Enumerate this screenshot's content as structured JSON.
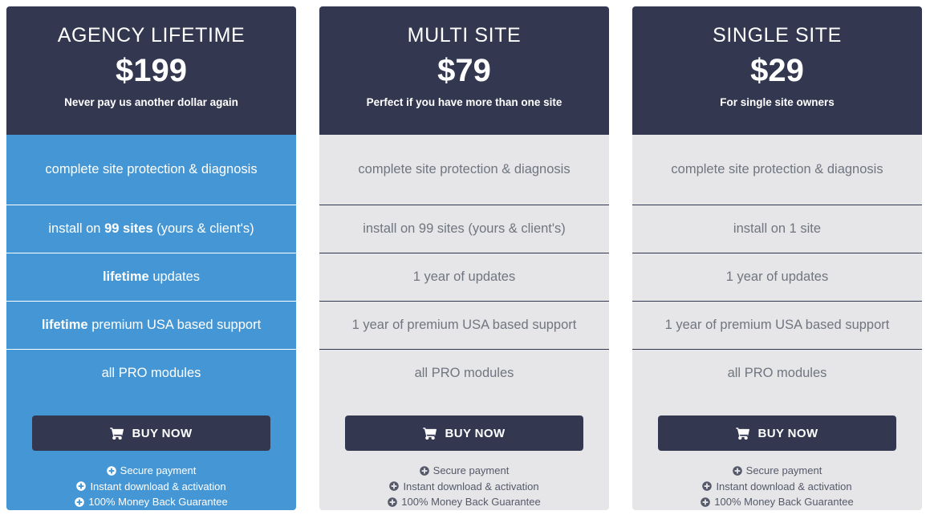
{
  "cards": [
    {
      "style": "featured",
      "plan_name": "AGENCY LIFETIME",
      "price": "$199",
      "tagline": "Never pay us another dollar again",
      "features": [
        {
          "pre": "complete site protection & diagnosis",
          "strong": "",
          "post": ""
        },
        {
          "pre": "install on ",
          "strong": "99 sites",
          "post": " (yours & client's)"
        },
        {
          "pre": "",
          "strong": "lifetime",
          "post": " updates"
        },
        {
          "pre": "",
          "strong": "lifetime",
          "post": " premium USA based support"
        }
      ],
      "modules_prefix": "all ",
      "modules_link": "PRO modules",
      "buy_label": "BUY NOW",
      "guarantees": [
        "Secure payment",
        "Instant download & activation",
        "100% Money Back Guarantee"
      ]
    },
    {
      "style": "standard",
      "plan_name": "MULTI SITE",
      "price": "$79",
      "tagline": "Perfect if you have more than one site",
      "features": [
        {
          "pre": "complete site protection & diagnosis",
          "strong": "",
          "post": ""
        },
        {
          "pre": "install on 99 sites (yours & client's)",
          "strong": "",
          "post": ""
        },
        {
          "pre": "1 year of updates",
          "strong": "",
          "post": ""
        },
        {
          "pre": "1 year of premium USA based support",
          "strong": "",
          "post": ""
        }
      ],
      "modules_prefix": "all ",
      "modules_link": "PRO modules",
      "buy_label": "BUY NOW",
      "guarantees": [
        "Secure payment",
        "Instant download & activation",
        "100% Money Back Guarantee"
      ]
    },
    {
      "style": "standard",
      "plan_name": "SINGLE SITE",
      "price": "$29",
      "tagline": "For single site owners",
      "features": [
        {
          "pre": "complete site protection & diagnosis",
          "strong": "",
          "post": ""
        },
        {
          "pre": "install on 1 site",
          "strong": "",
          "post": ""
        },
        {
          "pre": "1 year of updates",
          "strong": "",
          "post": ""
        },
        {
          "pre": "1 year of premium USA based support",
          "strong": "",
          "post": ""
        }
      ],
      "modules_prefix": "all ",
      "modules_link": "PRO modules",
      "buy_label": "BUY NOW",
      "guarantees": [
        "Secure payment",
        "Instant download & activation",
        "100% Money Back Guarantee"
      ]
    }
  ],
  "icons": {
    "cart": "cart-icon",
    "plus": "plus-circle-icon"
  },
  "colors": {
    "header_navy": "#333850",
    "featured_blue": "#4596d4",
    "standard_grey": "#e6e6e8",
    "link_blue": "#5b9bd5",
    "grey_text": "#70757f"
  }
}
